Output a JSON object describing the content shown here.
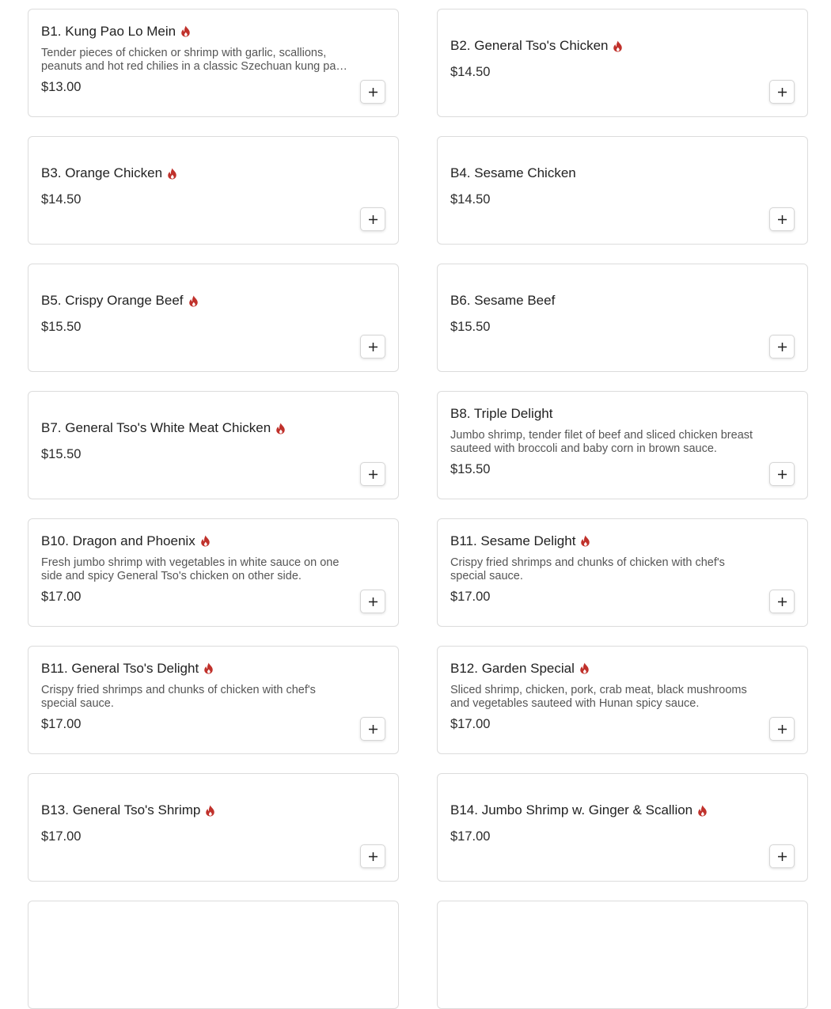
{
  "colors": {
    "spicy": "#c0312b",
    "border": "#dcdcdc"
  },
  "icons": {
    "spicy": "flame-icon",
    "add": "plus-icon"
  },
  "menu": {
    "items": [
      {
        "title": "B1. Kung Pao Lo Mein",
        "spicy": true,
        "description": "Tender pieces of chicken or shrimp with garlic, scallions, peanuts and hot red chilies in a classic Szechuan kung pao sauce.",
        "price": "$13.00"
      },
      {
        "title": "B2. General Tso's Chicken",
        "spicy": true,
        "description": "",
        "price": "$14.50"
      },
      {
        "title": "B3. Orange Chicken",
        "spicy": true,
        "description": "",
        "price": "$14.50"
      },
      {
        "title": "B4. Sesame Chicken",
        "spicy": false,
        "description": "",
        "price": "$14.50"
      },
      {
        "title": "B5. Crispy Orange Beef",
        "spicy": true,
        "description": "",
        "price": "$15.50"
      },
      {
        "title": "B6. Sesame Beef",
        "spicy": false,
        "description": "",
        "price": "$15.50"
      },
      {
        "title": "B7. General Tso's White Meat Chicken",
        "spicy": true,
        "description": "",
        "price": "$15.50"
      },
      {
        "title": "B8. Triple Delight",
        "spicy": false,
        "description": "Jumbo shrimp, tender filet of beef and sliced chicken breast sauteed with broccoli and baby corn in brown sauce.",
        "price": "$15.50"
      },
      {
        "title": "B10. Dragon and Phoenix",
        "spicy": true,
        "description": "Fresh jumbo shrimp with vegetables in white sauce on one side and spicy General Tso's chicken on other side.",
        "price": "$17.00"
      },
      {
        "title": "B11. Sesame Delight",
        "spicy": true,
        "description": "Crispy fried shrimps and chunks of chicken with chef's special sauce.",
        "price": "$17.00"
      },
      {
        "title": "B11. General Tso's Delight",
        "spicy": true,
        "description": "Crispy fried shrimps and chunks of chicken with chef's special sauce.",
        "price": "$17.00"
      },
      {
        "title": "B12. Garden Special",
        "spicy": true,
        "description": "Sliced shrimp, chicken, pork, crab meat, black mushrooms and vegetables sauteed with Hunan spicy sauce.",
        "price": "$17.00"
      },
      {
        "title": "B13. General Tso's Shrimp",
        "spicy": true,
        "description": "",
        "price": "$17.00"
      },
      {
        "title": "B14. Jumbo Shrimp w. Ginger & Scallion",
        "spicy": true,
        "description": "",
        "price": "$17.00"
      }
    ]
  }
}
